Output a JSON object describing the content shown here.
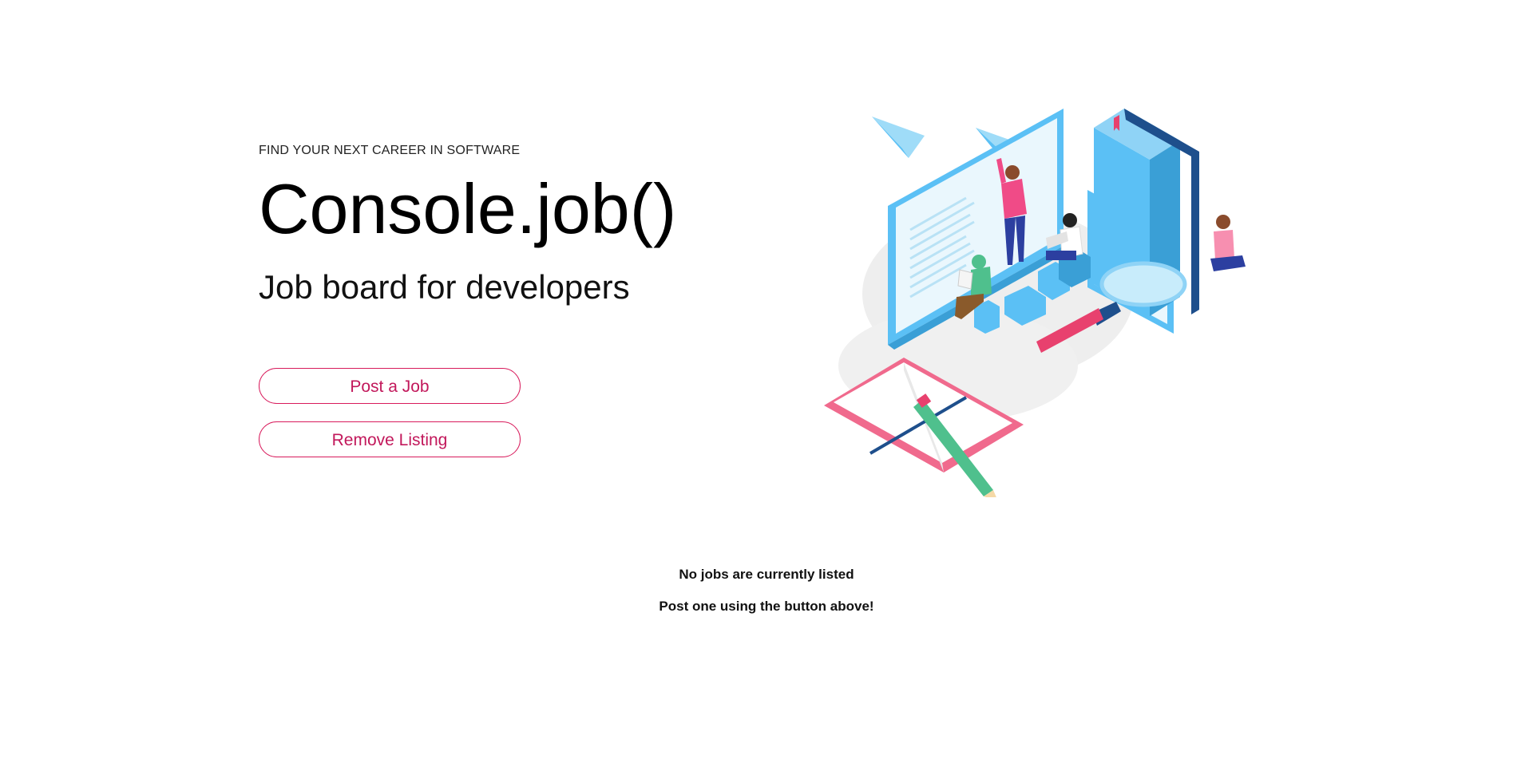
{
  "hero": {
    "eyebrow": "FIND YOUR NEXT CAREER IN SOFTWARE",
    "title": "Console.job()",
    "subtitle": "Job board for developers"
  },
  "actions": {
    "post_label": "Post a Job",
    "remove_label": "Remove Listing"
  },
  "empty_state": {
    "line1": "No jobs are currently listed",
    "line2": "Post one using the button above!"
  },
  "colors": {
    "accent": "#d81b5c",
    "monitor": "#5bc0f5",
    "book": "#1e4f8c"
  },
  "illustration": {
    "icon": "developers-workspace-illustration"
  }
}
